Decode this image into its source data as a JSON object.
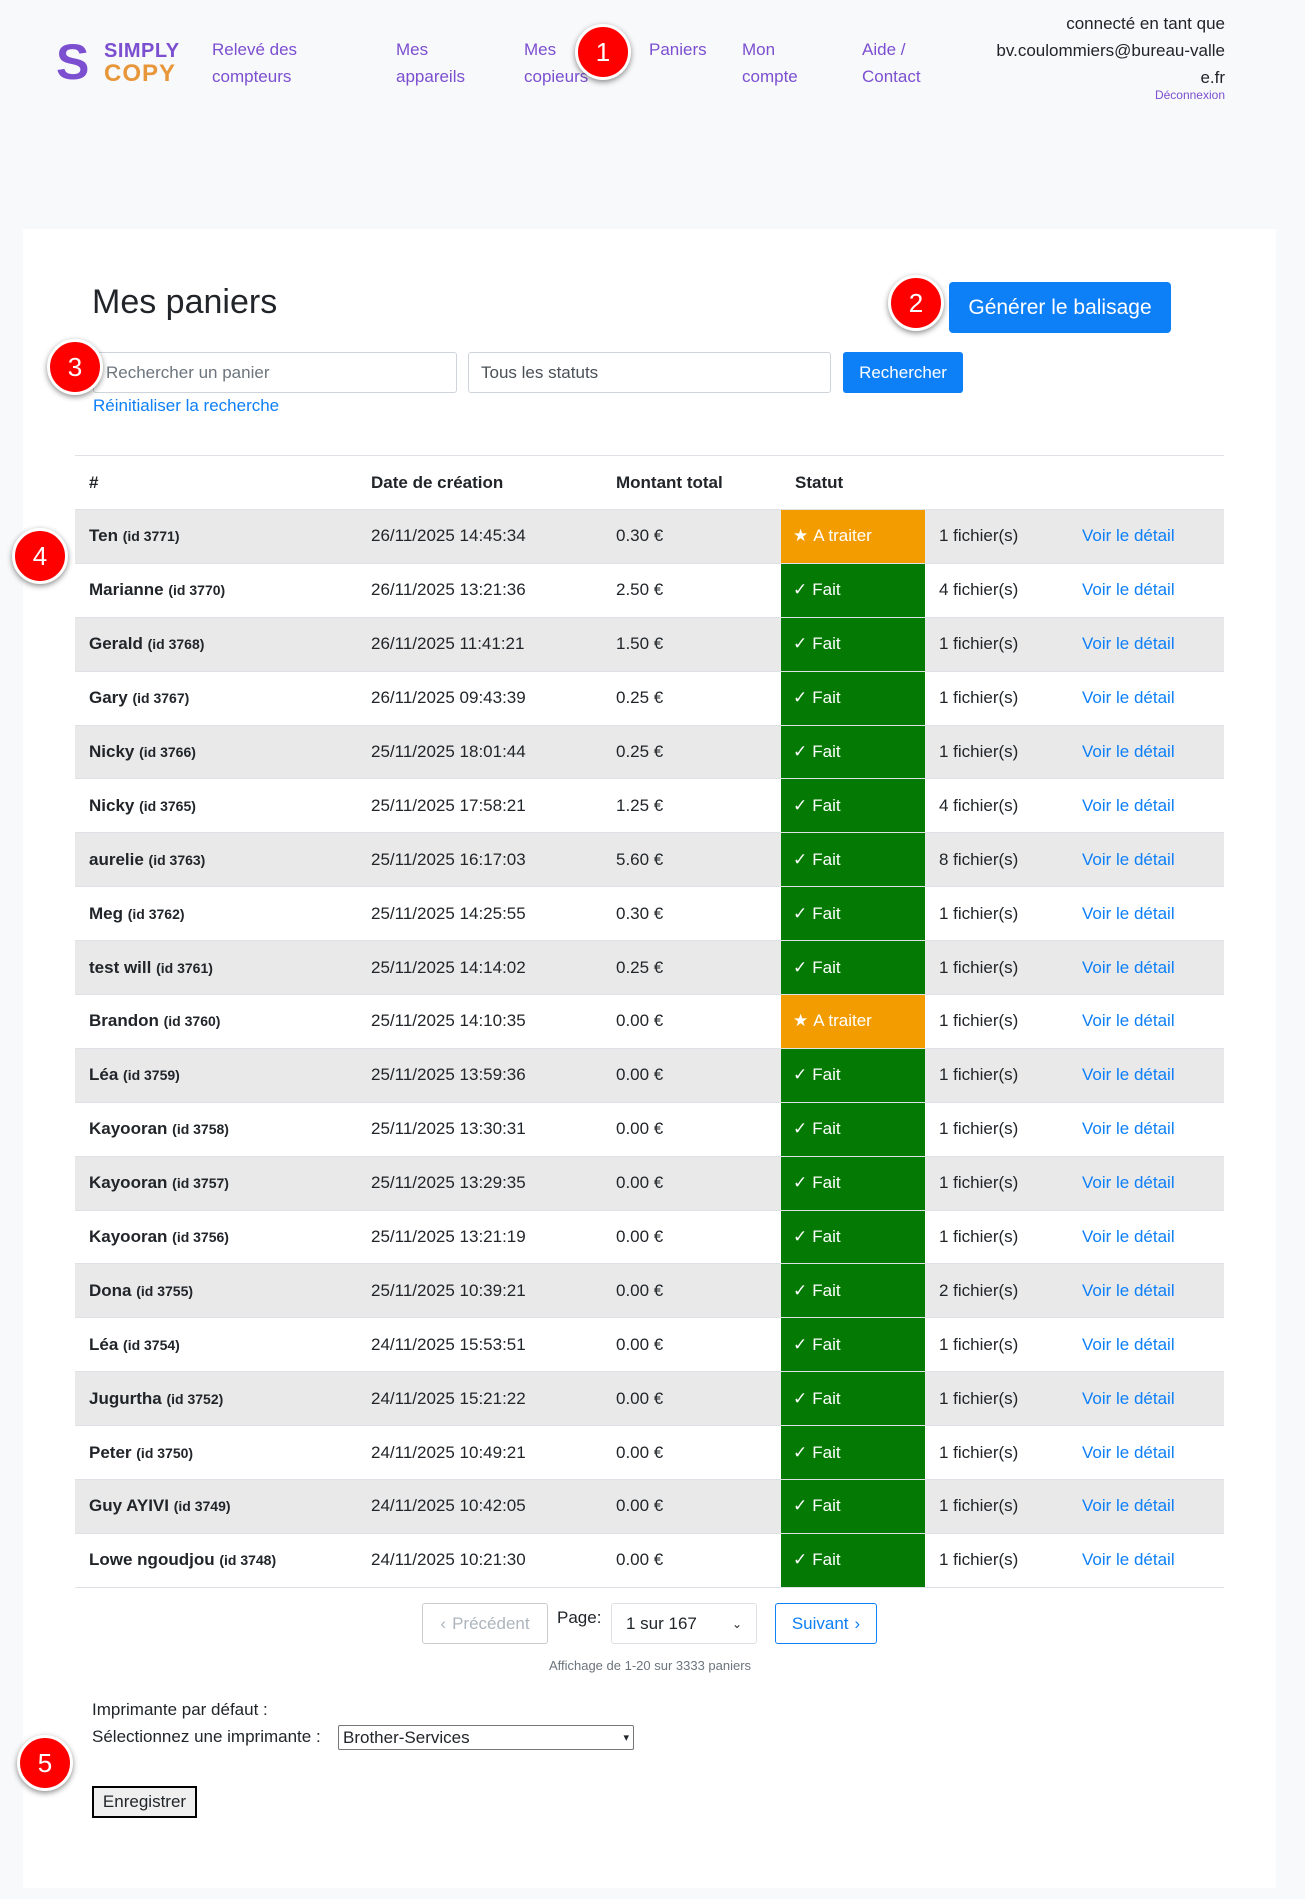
{
  "header": {
    "logo_top": "SIMPLY",
    "logo_bottom": "COPY",
    "nav": [
      "Relevé des compteurs",
      "Mes appareils",
      "Mes copieurs",
      "Paniers",
      "Mon compte",
      "Aide / Contact"
    ],
    "user_label": "connecté en tant que",
    "user_email": "bv.coulommiers@bureau-vallee.fr",
    "logout": "Déconnexion"
  },
  "main": {
    "title": "Mes paniers",
    "generate_button": "Générer le balisage",
    "search_placeholder": "Rechercher un panier",
    "status_filter": "Tous les statuts",
    "search_button": "Rechercher",
    "reset_link": "Réinitialiser la recherche"
  },
  "table": {
    "headers": [
      "#",
      "Date de création",
      "Montant total",
      "Statut"
    ],
    "rows": [
      {
        "name": "Ten",
        "id": "(id 3771)",
        "date": "26/11/2025 14:45:34",
        "amount": "0.30 €",
        "status": "A traiter",
        "files": "1 fichier(s)",
        "link": "Voir le détail"
      },
      {
        "name": "Marianne",
        "id": "(id 3770)",
        "date": "26/11/2025 13:21:36",
        "amount": "2.50 €",
        "status": "Fait",
        "files": "4 fichier(s)",
        "link": "Voir le détail"
      },
      {
        "name": "Gerald",
        "id": "(id 3768)",
        "date": "26/11/2025 11:41:21",
        "amount": "1.50 €",
        "status": "Fait",
        "files": "1 fichier(s)",
        "link": "Voir le détail"
      },
      {
        "name": "Gary",
        "id": "(id 3767)",
        "date": "26/11/2025 09:43:39",
        "amount": "0.25 €",
        "status": "Fait",
        "files": "1 fichier(s)",
        "link": "Voir le détail"
      },
      {
        "name": "Nicky",
        "id": "(id 3766)",
        "date": "25/11/2025 18:01:44",
        "amount": "0.25 €",
        "status": "Fait",
        "files": "1 fichier(s)",
        "link": "Voir le détail"
      },
      {
        "name": "Nicky",
        "id": "(id 3765)",
        "date": "25/11/2025 17:58:21",
        "amount": "1.25 €",
        "status": "Fait",
        "files": "4 fichier(s)",
        "link": "Voir le détail"
      },
      {
        "name": "aurelie",
        "id": "(id 3763)",
        "date": "25/11/2025 16:17:03",
        "amount": "5.60 €",
        "status": "Fait",
        "files": "8 fichier(s)",
        "link": "Voir le détail"
      },
      {
        "name": "Meg",
        "id": "(id 3762)",
        "date": "25/11/2025 14:25:55",
        "amount": "0.30 €",
        "status": "Fait",
        "files": "1 fichier(s)",
        "link": "Voir le détail"
      },
      {
        "name": "test will",
        "id": "(id 3761)",
        "date": "25/11/2025 14:14:02",
        "amount": "0.25 €",
        "status": "Fait",
        "files": "1 fichier(s)",
        "link": "Voir le détail"
      },
      {
        "name": "Brandon",
        "id": "(id 3760)",
        "date": "25/11/2025 14:10:35",
        "amount": "0.00 €",
        "status": "A traiter",
        "files": "1 fichier(s)",
        "link": "Voir le détail"
      },
      {
        "name": "Léa",
        "id": "(id 3759)",
        "date": "25/11/2025 13:59:36",
        "amount": "0.00 €",
        "status": "Fait",
        "files": "1 fichier(s)",
        "link": "Voir le détail"
      },
      {
        "name": "Kayooran",
        "id": "(id 3758)",
        "date": "25/11/2025 13:30:31",
        "amount": "0.00 €",
        "status": "Fait",
        "files": "1 fichier(s)",
        "link": "Voir le détail"
      },
      {
        "name": "Kayooran",
        "id": "(id 3757)",
        "date": "25/11/2025 13:29:35",
        "amount": "0.00 €",
        "status": "Fait",
        "files": "1 fichier(s)",
        "link": "Voir le détail"
      },
      {
        "name": "Kayooran",
        "id": "(id 3756)",
        "date": "25/11/2025 13:21:19",
        "amount": "0.00 €",
        "status": "Fait",
        "files": "1 fichier(s)",
        "link": "Voir le détail"
      },
      {
        "name": "Dona",
        "id": "(id 3755)",
        "date": "25/11/2025 10:39:21",
        "amount": "0.00 €",
        "status": "Fait",
        "files": "2 fichier(s)",
        "link": "Voir le détail"
      },
      {
        "name": "Léa",
        "id": "(id 3754)",
        "date": "24/11/2025 15:53:51",
        "amount": "0.00 €",
        "status": "Fait",
        "files": "1 fichier(s)",
        "link": "Voir le détail"
      },
      {
        "name": "Jugurtha",
        "id": "(id 3752)",
        "date": "24/11/2025 15:21:22",
        "amount": "0.00 €",
        "status": "Fait",
        "files": "1 fichier(s)",
        "link": "Voir le détail"
      },
      {
        "name": "Peter",
        "id": "(id 3750)",
        "date": "24/11/2025 10:49:21",
        "amount": "0.00 €",
        "status": "Fait",
        "files": "1 fichier(s)",
        "link": "Voir le détail"
      },
      {
        "name": "Guy AYIVI",
        "id": "(id 3749)",
        "date": "24/11/2025 10:42:05",
        "amount": "0.00 €",
        "status": "Fait",
        "files": "1 fichier(s)",
        "link": "Voir le détail"
      },
      {
        "name": "Lowe ngoudjou",
        "id": "(id 3748)",
        "date": "24/11/2025 10:21:30",
        "amount": "0.00 €",
        "status": "Fait",
        "files": "1 fichier(s)",
        "link": "Voir le détail"
      }
    ]
  },
  "pagination": {
    "prev": "Précédent",
    "page_label": "Page:",
    "page_value": "1 sur 167",
    "next": "Suivant",
    "summary": "Affichage de 1-20 sur 3333 paniers"
  },
  "printer": {
    "heading": "Imprimante par défaut :",
    "select_label": "Sélectionnez une imprimante :",
    "selected": "Brother-Services",
    "save": "Enregistrer"
  },
  "markers": [
    "1",
    "2",
    "3",
    "4",
    "5"
  ],
  "colors": {
    "done": "#047a04",
    "todo": "#f39c00",
    "primary": "#0d7ff7",
    "nav": "#7b4fd0"
  }
}
